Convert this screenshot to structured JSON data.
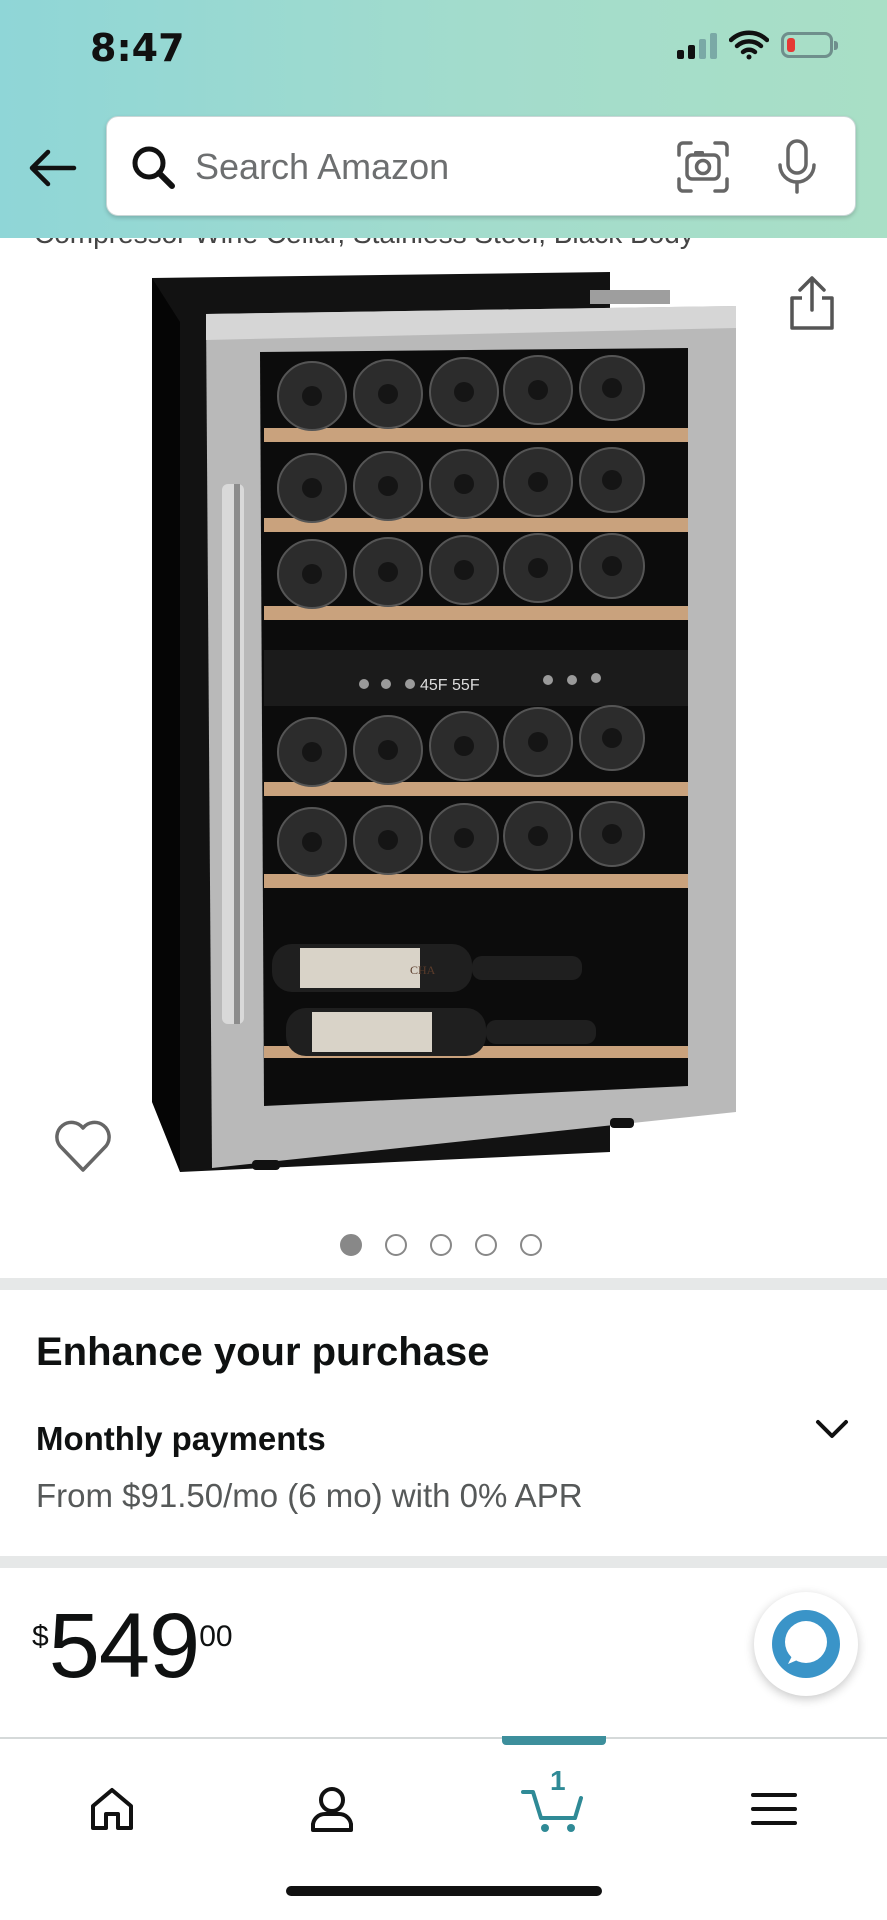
{
  "status_bar": {
    "time": "8:47"
  },
  "search": {
    "placeholder": "Search Amazon"
  },
  "product": {
    "title_fragment": "Compressor Wine Cellar, Stainless Steel, Black Body",
    "display_panel": "45F  55F",
    "bottle_label": "CHA",
    "image_count": 5,
    "active_image_index": 0
  },
  "enhance": {
    "title": "Enhance your purchase",
    "monthly_label": "Monthly payments",
    "monthly_detail": "From $91.50/mo (6 mo) with 0% APR"
  },
  "price": {
    "symbol": "$",
    "whole": "549",
    "fraction": "00"
  },
  "bottom_nav": {
    "items": [
      "home-icon",
      "account-icon",
      "cart-icon",
      "menu-icon"
    ],
    "cart_count": "1",
    "active": "cart"
  },
  "colors": {
    "header_gradient_start": "#8fd6d7",
    "header_gradient_end": "#a9dfc6",
    "cart_accent": "#3d8f9c",
    "alexa_blue": "#3a94c8"
  }
}
